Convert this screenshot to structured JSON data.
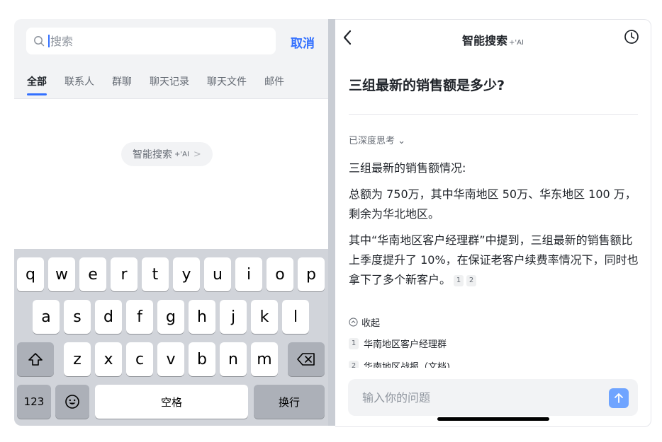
{
  "left": {
    "search": {
      "placeholder": "搜索",
      "cancel_label": "取消"
    },
    "tabs": [
      "全部",
      "联系人",
      "群聊",
      "聊天记录",
      "聊天文件",
      "邮件"
    ],
    "ai_pill": {
      "label": "智能搜索",
      "ai_mark": "+'AI",
      "chevron": ">"
    },
    "keyboard": {
      "row1": [
        "q",
        "w",
        "e",
        "r",
        "t",
        "y",
        "u",
        "i",
        "o",
        "p"
      ],
      "row2": [
        "a",
        "s",
        "d",
        "f",
        "g",
        "h",
        "j",
        "k",
        "l"
      ],
      "row3": [
        "z",
        "x",
        "c",
        "v",
        "b",
        "n",
        "m"
      ],
      "numbers_label": "123",
      "space_label": "空格",
      "return_label": "换行",
      "shift_icon": "shift-icon",
      "delete_icon": "delete-icon",
      "emoji_icon": "emoji-icon"
    }
  },
  "right": {
    "title": "智能搜索",
    "title_ai_mark": "+'AI",
    "question": "三组最新的销售额是多少?",
    "thinking_label": "已深度思考 ⌄",
    "answer": {
      "intro": "三组最新的销售额情况:",
      "p1": "总额为 750万，其中华南地区 50万、华东地区 100 万，剩余为华北地区。",
      "p2": "其中“华南地区客户经理群”中提到，三组最新的销售额比上季度提升了 10%，在保证老客户续费率情况下，同时也拿下了多个新客户。",
      "cite1": "1",
      "cite2": "2"
    },
    "collapse_label": "收起",
    "references": [
      {
        "num": "1",
        "label": "华南地区客户经理群"
      },
      {
        "num": "2",
        "label": "华南地区战报（文档)"
      }
    ],
    "ask_placeholder": "输入你的问题"
  },
  "colors": {
    "accent": "#3370ff",
    "send_button": "#6fa4ff"
  }
}
